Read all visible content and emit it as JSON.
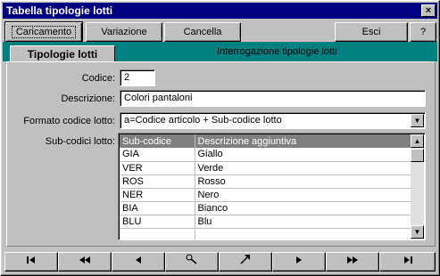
{
  "window": {
    "title": "Tabella tipologie lotti",
    "close_glyph": "×"
  },
  "toolbar": {
    "caricamento": "Caricamento",
    "variazione": "Variazione",
    "cancella": "Cancella",
    "esci": "Esci",
    "help": "?"
  },
  "tabs": {
    "active": "Tipologie lotti",
    "header_title": "Interrogazione tipologie lotti"
  },
  "form": {
    "codice_label": "Codice:",
    "codice_value": "2",
    "descrizione_label": "Descrizione:",
    "descrizione_value": "Colori pantaloni",
    "formato_label": "Formato codice lotto:",
    "formato_value": "a=Codice articolo + Sub-codice lotto",
    "subcodici_label": "Sub-codici lotto:"
  },
  "grid": {
    "columns": [
      "Sub-codice",
      "Descrizione aggiuntiva"
    ],
    "rows": [
      [
        "GIA",
        "Giallo"
      ],
      [
        "VER",
        "Verde"
      ],
      [
        "ROS",
        "Rosso"
      ],
      [
        "NER",
        "Nero"
      ],
      [
        "BIA",
        "Bianco"
      ],
      [
        "BLU",
        "Blu"
      ],
      [
        "",
        ""
      ]
    ]
  },
  "navigation": {
    "first": "first-record-icon",
    "prev_page": "previous-page-icon",
    "prev": "previous-record-icon",
    "find": "find-icon",
    "goto": "goto-icon",
    "next": "next-record-icon",
    "next_page": "next-page-icon",
    "last": "last-record-icon"
  }
}
